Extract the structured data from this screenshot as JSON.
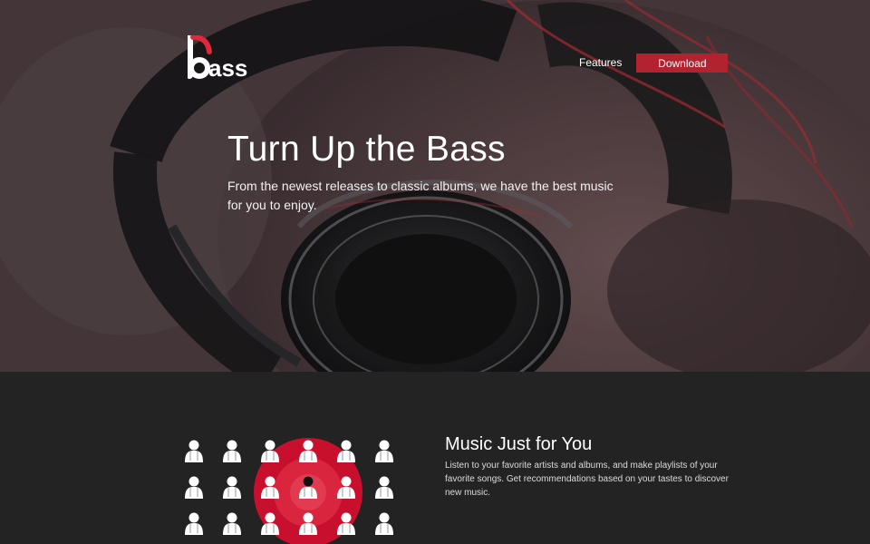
{
  "brand": {
    "logo_text": "bass",
    "accent": "#e0283c"
  },
  "nav": {
    "features_label": "Features",
    "download_label": "Download",
    "download_color": "#b2222f"
  },
  "hero": {
    "title": "Turn Up the Bass",
    "subtitle": "From the newest releases to classic albums, we have the best music for you to enjoy.",
    "background": "headphones-photo"
  },
  "feature": {
    "title": "Music Just for You",
    "text": "Listen to your favorite artists and albums, and make playlists of your favorite songs. Get recommendations based on your tastes to discover new music.",
    "illustration": "people-grid-icon",
    "highlight_color": "#c8102e"
  }
}
